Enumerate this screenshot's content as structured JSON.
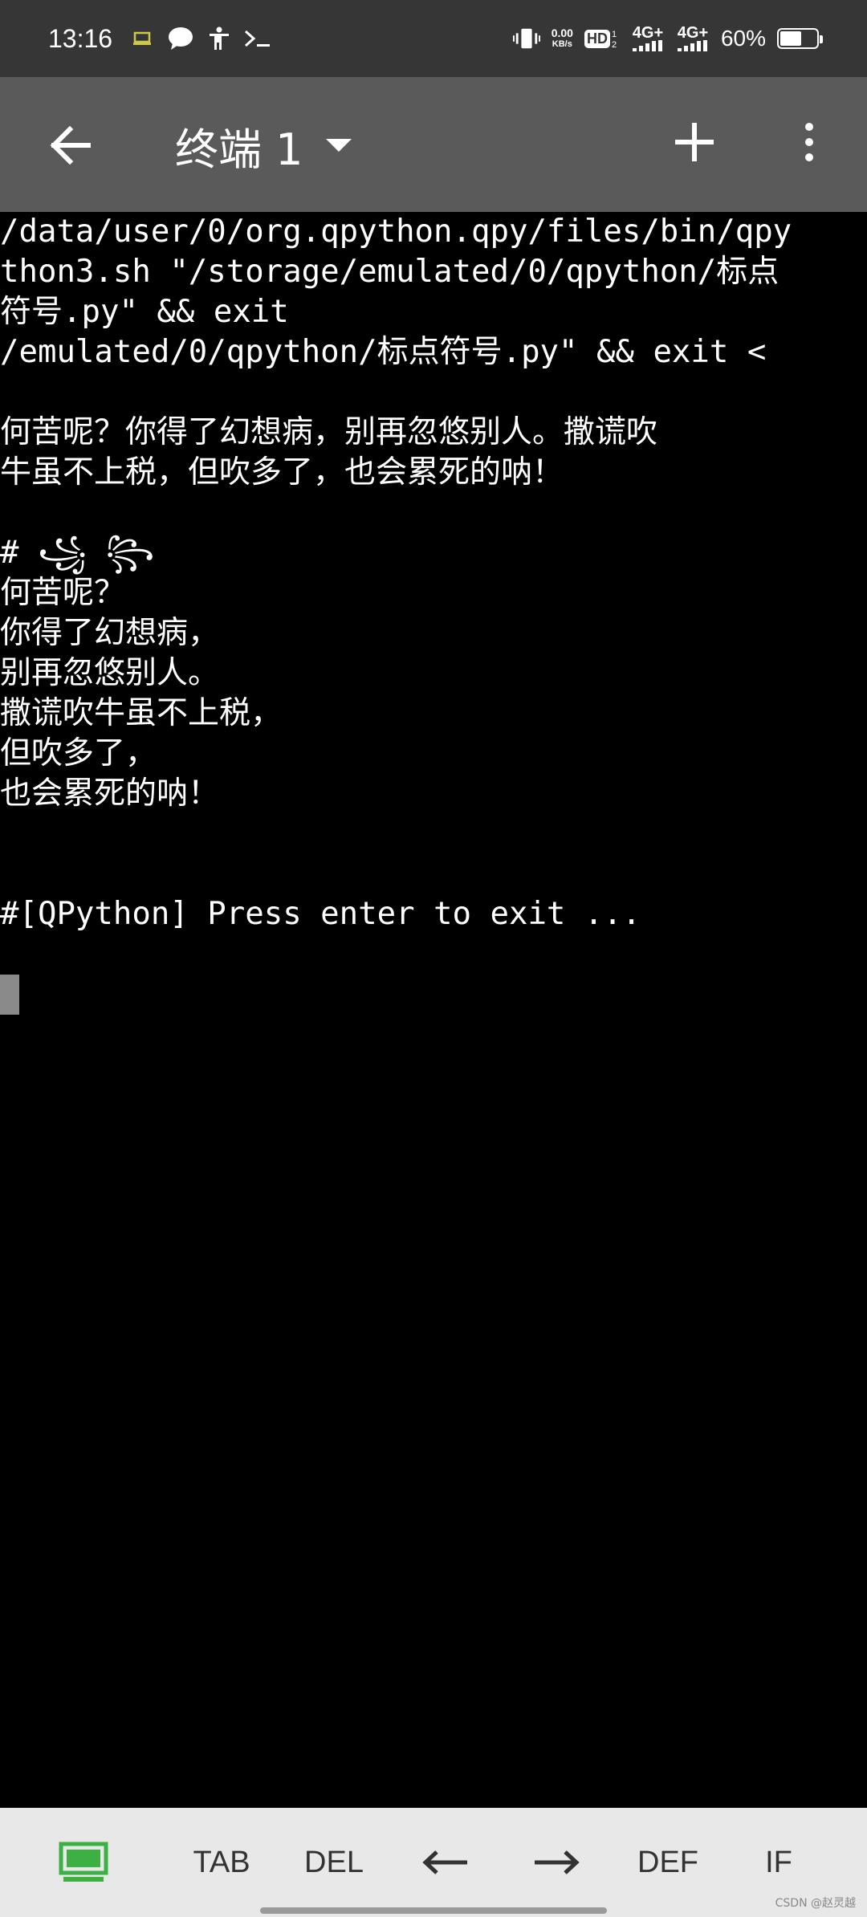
{
  "status_bar": {
    "time": "13:16",
    "net_speed_value": "0.00",
    "net_speed_unit": "KB/s",
    "hd_label": "HD",
    "sim1_type": "4G+",
    "sim2_type": "4G+",
    "battery_percent": "60%",
    "battery_level": 0.6
  },
  "app_bar": {
    "title": "终端 1"
  },
  "terminal": {
    "lines": [
      "/data/user/0/org.qpython.qpy/files/bin/qpy",
      "thon3.sh \"/storage/emulated/0/qpython/标点",
      "符号.py\" && exit",
      "/emulated/0/qpython/标点符号.py\" && exit <",
      "",
      "何苦呢？你得了幻想病，别再忽悠别人。撒谎吹",
      "牛虽不上税，但吹多了，也会累死的呐！",
      "",
      "# ꧁ ꧂",
      "何苦呢？",
      "你得了幻想病，",
      "别再忽悠别人。",
      "撒谎吹牛虽不上税，",
      "但吹多了，",
      "也会累死的呐！",
      "",
      "",
      "#[QPython] Press enter to exit ...",
      ""
    ]
  },
  "key_bar": {
    "keys": [
      "TAB",
      "DEL",
      "←",
      "→",
      "DEF",
      "IF"
    ]
  },
  "watermark": "CSDN @赵灵越",
  "colors": {
    "status_bar_bg": "#363636",
    "app_bar_bg": "#5a5a5a",
    "terminal_bg": "#000000",
    "key_bar_bg": "#e8e8e8",
    "keyboard_icon_green": "#3cb043"
  }
}
